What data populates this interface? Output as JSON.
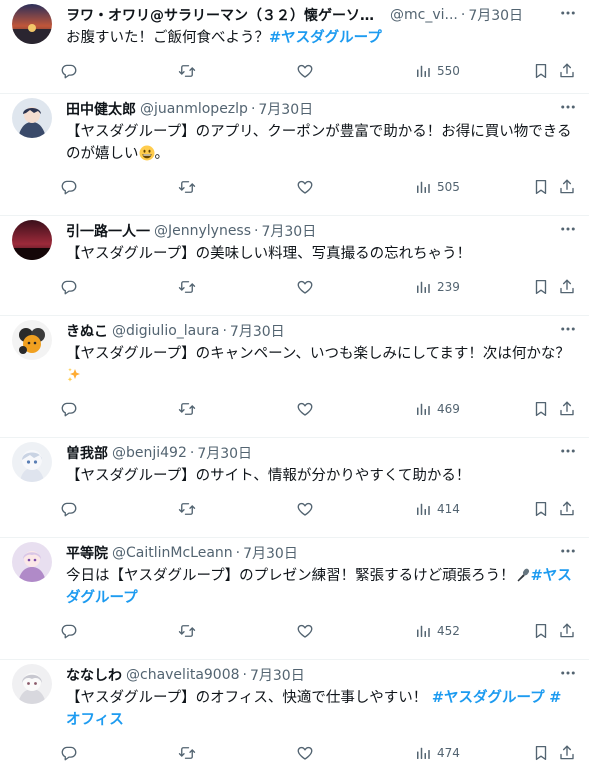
{
  "colors": {
    "accent": "#1d9bf0",
    "text": "#0f1419",
    "secondary": "#536471",
    "divider": "#eff3f4"
  },
  "icons": {
    "reply": "reply-icon",
    "retweet": "retweet-icon",
    "like": "heart-icon",
    "views": "views-bar-chart-icon",
    "bookmark": "bookmark-icon",
    "share": "share-icon",
    "more": "more-dots-icon"
  },
  "tweets": [
    {
      "name": "ヲワ・オワリ@サラリーマン（３２）懐ゲーソロ...",
      "handle": "@mc_vi...",
      "time": "7月30日",
      "text": "お腹すいた！ご飯何食べよう？",
      "hashtag1": "#ヤスダグループ",
      "views": "550"
    },
    {
      "name": "田中健太郎",
      "handle": "@juanmlopezlp",
      "time": "7月30日",
      "text": "【ヤスダグループ】のアプリ、クーポンが豊富で助かる！お得に買い物できるのが嬉しい",
      "emoji": "grinning-face-emoji",
      "text_end": "。",
      "views": "505"
    },
    {
      "name": "引一路一人一",
      "handle": "@Jennylyness",
      "time": "7月30日",
      "text": "【ヤスダグループ】の美味しい料理、写真撮るの忘れちゃう！",
      "views": "239"
    },
    {
      "name": "きぬこ",
      "handle": "@digiulio_laura",
      "time": "7月30日",
      "text": "【ヤスダグループ】のキャンペーン、いつも楽しみにしてます！次は何かな？",
      "emoji": "sparkles-emoji",
      "views": "469"
    },
    {
      "name": "曽我部",
      "handle": "@benji492",
      "time": "7月30日",
      "text": "【ヤスダグループ】のサイト、情報が分かりやすくて助かる！",
      "views": "414"
    },
    {
      "name": "平等院",
      "handle": "@CaitlinMcLeann",
      "time": "7月30日",
      "text": "今日は【ヤスダグループ】のプレゼン練習！緊張するけど頑張ろう！",
      "emoji": "microphone-emoji",
      "hashtag1": "#ヤスダグループ",
      "views": "452"
    },
    {
      "name": "ななしわ",
      "handle": "@chavelita9008",
      "time": "7月30日",
      "text": "【ヤスダグループ】のオフィス、快適で仕事しやすい！",
      "hashtag1": "#ヤスダグループ",
      "hashtag2": "#オフィス",
      "views": "474"
    }
  ]
}
